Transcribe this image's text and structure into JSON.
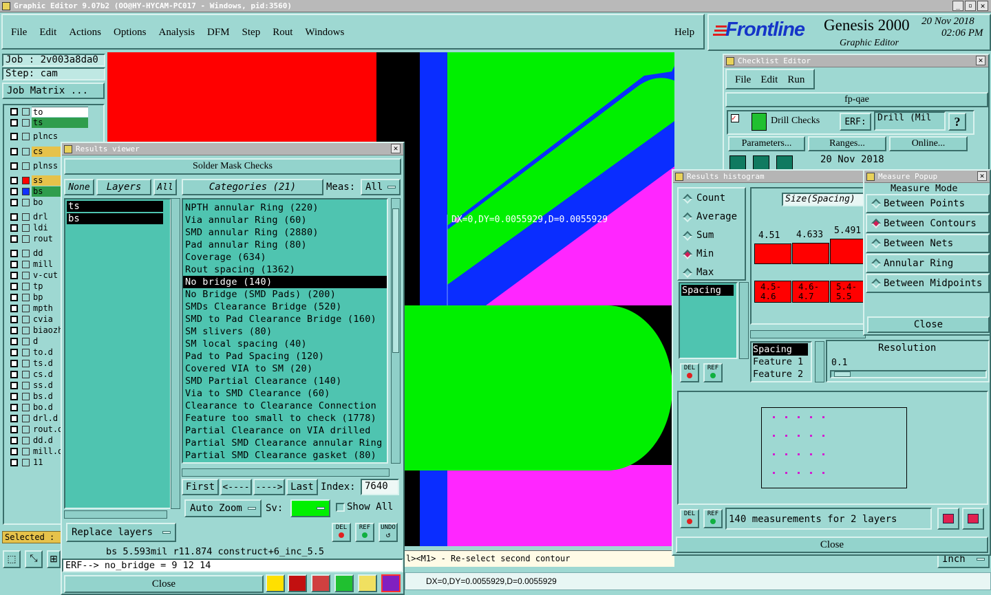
{
  "titlebar": {
    "title": "Graphic Editor 9.07b2  (OO@HY-HYCAM-PC017 - Windows, pid:3560)"
  },
  "menu": {
    "items": [
      "File",
      "Edit",
      "Actions",
      "Options",
      "Analysis",
      "DFM",
      "Step",
      "Rout",
      "Windows"
    ],
    "help": "Help"
  },
  "brand": {
    "logo": "Frontline",
    "product": "Genesis 2000",
    "subtitle": "Graphic Editor",
    "date": "20 Nov 2018",
    "time": "02:06 PM"
  },
  "job": {
    "job": "Job : 2v003a8da0",
    "step": "Step: cam",
    "matrix": "Job Matrix ..."
  },
  "layers": [
    "to",
    "ts",
    "plncs",
    "cs",
    "plnss",
    "ss",
    "bs",
    "bo",
    "drl",
    "ldi",
    "rout",
    "dd",
    "mill",
    "v-cut",
    "tp",
    "bp",
    "mpth",
    "cvia",
    "biaozhu",
    "d",
    "to.d",
    "ts.d",
    "cs.d",
    "ss.d",
    "bs.d",
    "bo.d",
    "drl.d",
    "rout.d",
    "dd.d",
    "mill.d",
    "11"
  ],
  "selected_label": "Selected : ",
  "canvas": {
    "measure_text": "DX=0,DY=0.0055929,D=0.0055929"
  },
  "results_viewer": {
    "title": "Results viewer",
    "header": "Solder Mask Checks",
    "none": "None",
    "layers": "Layers",
    "all": "All",
    "categories_label": "Categories (21)",
    "meas_label": "Meas:",
    "meas_value": "All",
    "layer_list": [
      "ts",
      "bs"
    ],
    "categories": [
      "NPTH annular Ring (220)",
      "Via annular Ring (60)",
      "SMD annular Ring (2880)",
      "Pad annular Ring (80)",
      "Coverage (634)",
      "Rout spacing (1362)",
      "No bridge (140)",
      "No Bridge (SMD Pads) (200)",
      "SMDs Clearance Bridge (520)",
      "SMD to Pad Clearance Bridge (160)",
      "SM slivers (80)",
      "SM local spacing (40)",
      "Pad to Pad Spacing (120)",
      "Covered VIA to SM (20)",
      "SMD Partial Clearance (140)",
      "Via to SMD Clearance (60)",
      "Clearance to Clearance Connection",
      "Feature too small to check (1778)",
      "Partial Clearance on VIA drilled",
      "Partial SMD Clearance annular Ring",
      "Partial SMD Clearance gasket (80)"
    ],
    "selected_category": "No bridge (140)",
    "nav": {
      "first": "First",
      "prev": "<----",
      "next": "---->",
      "last": "Last",
      "index_label": "Index:",
      "index_value": "7640"
    },
    "auto_zoom": "Auto Zoom",
    "sv": "Sv:",
    "show_all": "Show All",
    "replace_layers": "Replace layers",
    "del": "DEL",
    "ref": "REF",
    "undo": "UNDO",
    "status": "bs 5.593mil  r11.874  construct+6_inc_5.5",
    "erf": "ERF--> no_bridge = 9 12 14",
    "close": "Close"
  },
  "checklist": {
    "title": "Checklist Editor",
    "menu": [
      "File",
      "Edit",
      "Run"
    ],
    "name": "fp-qae",
    "action": "Drill Checks",
    "erf_label": "ERF:",
    "erf_value": "Drill (Mil",
    "help": "?",
    "parameters": "Parameters...",
    "ranges": "Ranges...",
    "online": "Online...",
    "date": "20 Nov 2018"
  },
  "histogram": {
    "title": "Results histogram",
    "options": [
      "Count",
      "Average",
      "Sum",
      "Min",
      "Max"
    ],
    "selected_option": "Min",
    "list": [
      "Spacing"
    ],
    "graph_label": "Size(Spacing)",
    "bars": [
      {
        "value": "4.51",
        "range": "4.5-4.6",
        "level": 0.44
      },
      {
        "value": "4.633",
        "range": "4.6-4.7",
        "level": 0.46
      },
      {
        "value": "5.491",
        "range": "5.4-5.5",
        "level": 0.55
      }
    ],
    "fields": [
      "Spacing",
      "Feature 1",
      "Feature 2"
    ],
    "resolution_label": "Resolution",
    "resolution_value": "0.1",
    "measurements": "140 measurements for 2 layers",
    "close": "Close"
  },
  "measure": {
    "title": "Measure Popup",
    "header": "Measure Mode",
    "modes": [
      "Between Points",
      "Between Contours",
      "Between Nets",
      "Annular Ring",
      "Between Midpoints"
    ],
    "selected_mode": "Between Contours",
    "close": "Close"
  },
  "statusbar": {
    "hint": "l><M1> - Re-select second contour",
    "measure": "DX=0,DY=0.0055929,D=0.0055929",
    "units": "Inch"
  },
  "colors": {
    "panel": "#9ed8d2",
    "list_bg": "#4fc4b0",
    "red": "#ff0000",
    "green": "#00f000",
    "blue": "#0a2dff",
    "magenta": "#ff26ff",
    "cyan": "#00ffff"
  }
}
